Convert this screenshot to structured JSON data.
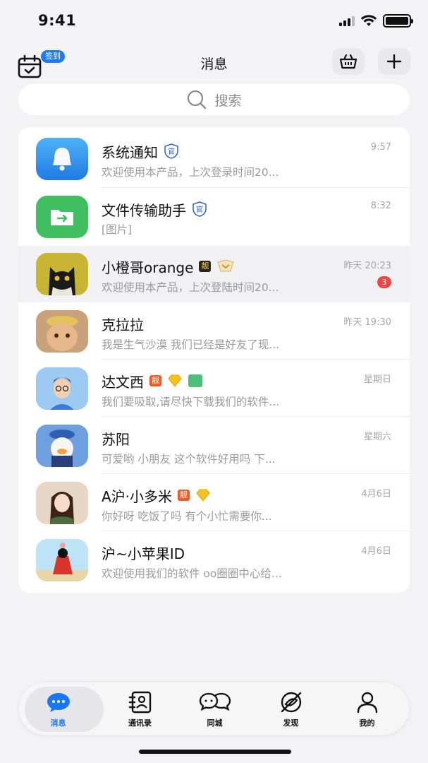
{
  "status_bar": {
    "time": "9:41"
  },
  "header": {
    "title": "消息",
    "checkin_badge": "签到",
    "icons": [
      "calendar-icon",
      "basket-icon",
      "plus-icon"
    ]
  },
  "search": {
    "placeholder": "搜索"
  },
  "conversations": [
    {
      "name": "系统通知",
      "preview": "欢迎使用本产品，上次登录时间20...",
      "time": "9:57",
      "badges": [
        "官"
      ]
    },
    {
      "name": "文件传输助手",
      "preview": "[图片]",
      "time": "8:32",
      "badges": [
        "官"
      ]
    },
    {
      "name": "小橙哥orange",
      "preview": "欢迎使用本产品，上次登陆时间20...",
      "time": "昨天 20:23",
      "unread": "3",
      "badges": [
        "靓"
      ]
    },
    {
      "name": "克拉拉",
      "preview": "我是生气沙漠 我们已经是好友了现...",
      "time": "昨天 19:30"
    },
    {
      "name": "达文西",
      "preview": "我们要吸取,请尽快下载我们的软件...",
      "time": "星期日",
      "badges": [
        "靓"
      ]
    },
    {
      "name": "苏阳",
      "preview": "可爱哟 小朋友 这个软件好用吗 下...",
      "time": "星期六"
    },
    {
      "name": "A沪·小多米",
      "preview": "你好呀 吃饭了吗 有个小忙需要你...",
      "time": "4月6日",
      "badges": [
        "靓"
      ]
    },
    {
      "name": "沪~小苹果ID",
      "preview": "欢迎使用我们的软件 oo圈圈中心给...",
      "time": "4月6日"
    }
  ],
  "tabbar": {
    "tabs": [
      {
        "label": "消息",
        "icon": "chat-bubble-icon",
        "active": true
      },
      {
        "label": "通讯录",
        "icon": "contacts-icon"
      },
      {
        "label": "同城",
        "icon": "double-chat-icon"
      },
      {
        "label": "发现",
        "icon": "discover-icon"
      },
      {
        "label": "我的",
        "icon": "profile-icon"
      }
    ]
  },
  "colors": {
    "accent": "#1a76f2",
    "unread": "#ee4444",
    "official": "#2f5fd0"
  }
}
